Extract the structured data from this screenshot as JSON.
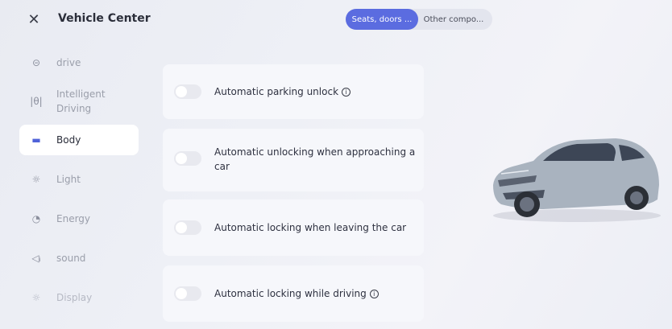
{
  "header": {
    "close_glyph": "✕",
    "title": "Vehicle Center"
  },
  "segments": [
    {
      "label": "Seats, doors ...",
      "active": true
    },
    {
      "label": "Other compo...",
      "active": false
    }
  ],
  "sidebar": {
    "items": [
      {
        "icon": "steering-wheel-icon",
        "glyph": "⊝",
        "label": "drive"
      },
      {
        "icon": "intelligent-driving-icon",
        "glyph": "|θ|",
        "label": "Intelligent Driving"
      },
      {
        "icon": "car-body-icon",
        "glyph": "▬",
        "label": "Body"
      },
      {
        "icon": "light-icon",
        "glyph": "☼",
        "label": "Light"
      },
      {
        "icon": "energy-icon",
        "glyph": "◔",
        "label": "Energy"
      },
      {
        "icon": "sound-icon",
        "glyph": "◁ᵢ",
        "label": "sound"
      },
      {
        "icon": "display-icon",
        "glyph": "☼",
        "label": "Display"
      }
    ],
    "active_index": 2
  },
  "settings": [
    {
      "label": "Automatic parking unlock",
      "info": true,
      "enabled": false
    },
    {
      "label": "Automatic unlocking when approaching a car",
      "info": false,
      "enabled": false
    },
    {
      "label": "Automatic locking when leaving the car",
      "info": false,
      "enabled": false
    },
    {
      "label": "Automatic locking while driving",
      "info": true,
      "enabled": false
    }
  ],
  "colors": {
    "accent": "#5b6ce0",
    "background": "#eef0f6",
    "card": "#f6f7fb"
  }
}
